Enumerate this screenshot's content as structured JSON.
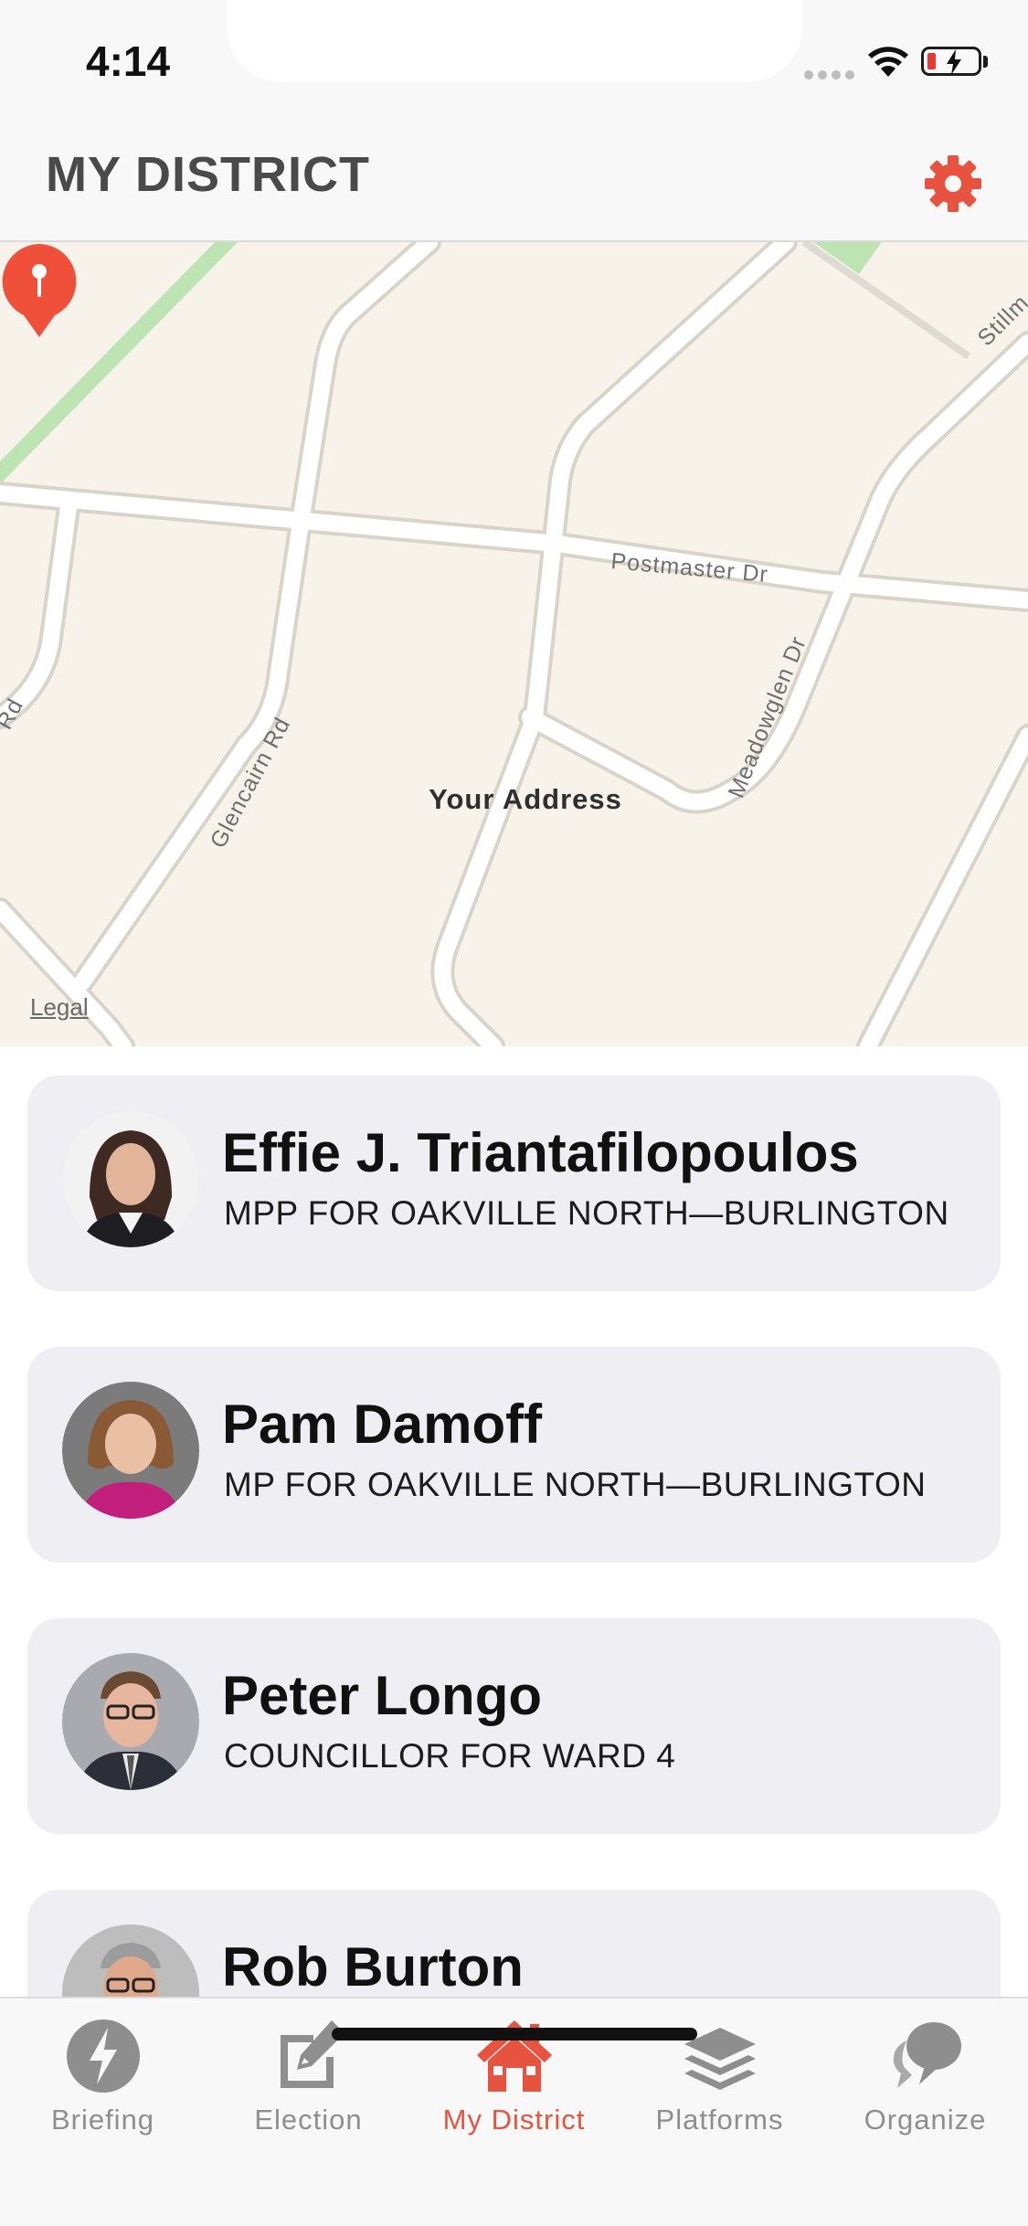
{
  "status": {
    "time": "4:14"
  },
  "header": {
    "title": "MY DISTRICT"
  },
  "map": {
    "street_labels": [
      "Postmaster Dr",
      "Meadowglen Dr",
      "Glencairn Rd",
      "Stillm",
      "Rd"
    ],
    "pin_label": "Your Address",
    "legal_label": "Legal"
  },
  "representatives": [
    {
      "name": "Effie J. Triantafilopoulos",
      "role": "MPP FOR OAKVILLE NORTH—BURLINGTON"
    },
    {
      "name": "Pam Damoff",
      "role": "MP FOR OAKVILLE NORTH—BURLINGTON"
    },
    {
      "name": "Peter Longo",
      "role": "COUNCILLOR FOR WARD 4"
    },
    {
      "name": "Rob Burton",
      "role": ""
    }
  ],
  "tabs": [
    {
      "label": "Briefing",
      "icon": "lightning-icon"
    },
    {
      "label": "Election",
      "icon": "edit-icon"
    },
    {
      "label": "My District",
      "icon": "home-icon",
      "active": true
    },
    {
      "label": "Platforms",
      "icon": "layers-icon"
    },
    {
      "label": "Organize",
      "icon": "chat-bubbles-icon"
    }
  ],
  "colors": {
    "accent": "#e8533f",
    "card": "#efeef3",
    "map_bg": "#f7f2ea",
    "inactive": "#8e8e8e"
  }
}
